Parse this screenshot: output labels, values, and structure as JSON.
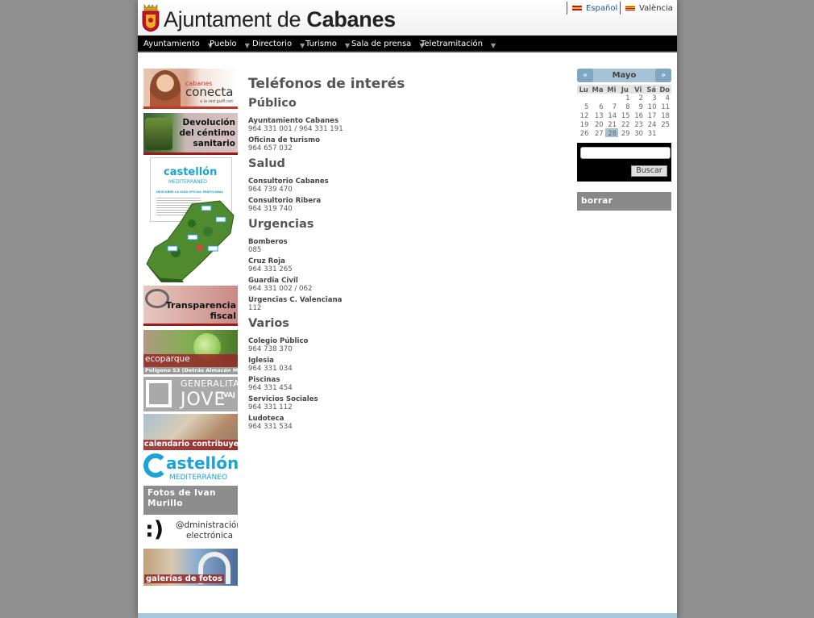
{
  "header": {
    "title_prefix": "Ajuntament de",
    "title_bold": "Cabanes",
    "languages": [
      "Español",
      "València"
    ]
  },
  "nav": {
    "items": [
      "Ayuntamiento",
      "Pueblo",
      "Directorio",
      "Turismo",
      "Sala de prensa",
      "Teletramitación"
    ]
  },
  "banners": {
    "conecta_small": "cabanes",
    "conecta_big": "conecta",
    "conecta_sub": "a la red guifi.net",
    "centimo_l1": "Devolución",
    "centimo_l2": "del céntimo",
    "centimo_l3": "sanitario",
    "castellon_title": "castellón",
    "castellon_sub": "MEDITERRÁNEO",
    "guia_title": "DESCUBRE LA GUÍA OFICIAL MULTICANAL",
    "transparencia_l1": "Transparencia",
    "transparencia_l2": "fiscal",
    "ecoparque_title": "ecoparque",
    "ecoparque_sub": "Polígono S3 (Detrás Almacén Mpal.)",
    "generalitat": "GENERALITAT",
    "jove": "JOVE",
    "ivaj": "IVAJ",
    "calendario": "calendario contribuyente",
    "castellon2_title": "astellón",
    "castellon2_sub": "MEDITERRÁNEO",
    "fotos_ivan": "Fotos de Ivan Murillo",
    "admin_l1": "@dministración",
    "admin_l2": "electrónica",
    "galerias": "galerías de fotos"
  },
  "content": {
    "title": "Teléfonos de interés",
    "sections": [
      {
        "heading": "Público",
        "entries": [
          {
            "name": "Ayuntamiento Cabanes",
            "phone": "964 331 001 / 964 331 191"
          },
          {
            "name": "Oficina de turismo",
            "phone": "964 657 032"
          }
        ]
      },
      {
        "heading": "Salud",
        "entries": [
          {
            "name": "Consultorio Cabanes",
            "phone": "964 739 470"
          },
          {
            "name": "Consultorio Ribera",
            "phone": "964 319 740"
          }
        ]
      },
      {
        "heading": "Urgencias",
        "entries": [
          {
            "name": "Bomberos",
            "phone": "085"
          },
          {
            "name": "Cruz Roja",
            "phone": "964 331 265"
          },
          {
            "name": "Guardia Civil",
            "phone": "964 331 002 / 062"
          },
          {
            "name": "Urgencias C. Valenciana",
            "phone": "112"
          }
        ]
      },
      {
        "heading": "Varios",
        "entries": [
          {
            "name": "Colegio Público",
            "phone": "964 738 370"
          },
          {
            "name": "Iglesia",
            "phone": "964 331 034"
          },
          {
            "name": "Piscinas",
            "phone": "964 331 454"
          },
          {
            "name": "Servicios Sociales",
            "phone": "964 331 112"
          },
          {
            "name": "Ludoteca",
            "phone": "964 331 534"
          }
        ]
      }
    ]
  },
  "calendar": {
    "month": "Mayo",
    "prev": "«",
    "next": "»",
    "weekdays": [
      "Lu",
      "Ma",
      "Mi",
      "Ju",
      "Vi",
      "Sá",
      "Do"
    ],
    "weeks": [
      [
        "",
        "",
        "",
        "",
        "1",
        "2",
        "3",
        "4"
      ],
      [
        "5",
        "6",
        "7",
        "8",
        "9",
        "10",
        "11"
      ],
      [
        "12",
        "13",
        "14",
        "15",
        "16",
        "17",
        "18"
      ],
      [
        "19",
        "20",
        "21",
        "22",
        "23",
        "24",
        "25"
      ],
      [
        "26",
        "27",
        "28",
        "29",
        "30",
        "31",
        ""
      ]
    ],
    "highlighted_day": "28"
  },
  "search": {
    "value": "",
    "button_label": "Buscar"
  },
  "sidebar_right": {
    "borrar_label": "borrar"
  },
  "colors": {
    "nav_bg": "#000000",
    "calendar_accent": "#a6c3d6",
    "link_blue": "#1a56a6"
  }
}
